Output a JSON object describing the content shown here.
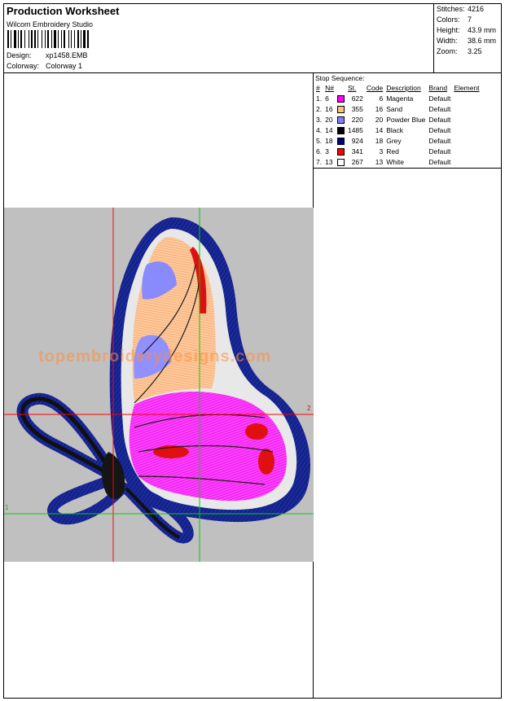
{
  "header": {
    "title": "Production Worksheet",
    "software": "Wilcom Embroidery Studio",
    "design_label": "Design:",
    "design_value": "xp1458.EMB",
    "colorway_label": "Colorway:",
    "colorway_value": "Colorway 1"
  },
  "stats": [
    {
      "label": "Stitches:",
      "value": "4216"
    },
    {
      "label": "Colors:",
      "value": "7"
    },
    {
      "label": "Height:",
      "value": "43.9 mm"
    },
    {
      "label": "Width:",
      "value": "38.6 mm"
    },
    {
      "label": "Zoom:",
      "value": "3.25"
    }
  ],
  "stop_sequence": {
    "title": "Stop Sequence:",
    "columns": [
      "#",
      "N#",
      "St.",
      "Code",
      "Description",
      "Brand",
      "Element"
    ],
    "rows": [
      {
        "index": "1.",
        "n": "6",
        "color": "#ff00ff",
        "st": "622",
        "code": "6",
        "description": "Magenta",
        "brand": "Default"
      },
      {
        "index": "2.",
        "n": "16",
        "color": "#ffc080",
        "st": "355",
        "code": "16",
        "description": "Sand",
        "brand": "Default"
      },
      {
        "index": "3.",
        "n": "20",
        "color": "#8080ff",
        "st": "220",
        "code": "20",
        "description": "Powder Blue",
        "brand": "Default"
      },
      {
        "index": "4.",
        "n": "14",
        "color": "#000000",
        "st": "1485",
        "code": "14",
        "description": "Black",
        "brand": "Default"
      },
      {
        "index": "5.",
        "n": "18",
        "color": "#000080",
        "st": "924",
        "code": "18",
        "description": "Grey",
        "brand": "Default"
      },
      {
        "index": "6.",
        "n": "3",
        "color": "#ff0000",
        "st": "341",
        "code": "3",
        "description": "Red",
        "brand": "Default"
      },
      {
        "index": "7.",
        "n": "13",
        "color": "#ffffff",
        "st": "267",
        "code": "13",
        "description": "White",
        "brand": "Default"
      }
    ]
  },
  "design": {
    "watermark": "topembroiderydesigns.com",
    "axis_red_label": "2",
    "axis_green_label": "1"
  }
}
